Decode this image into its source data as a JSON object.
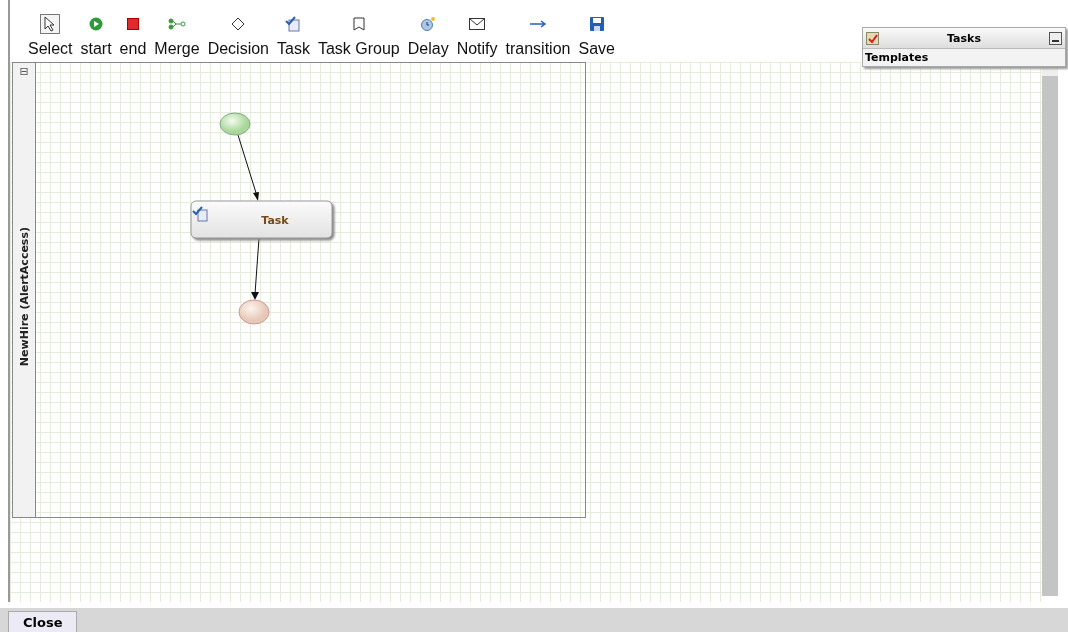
{
  "toolbar": [
    {
      "kind": "select",
      "label": "Select",
      "selected": true
    },
    {
      "kind": "start",
      "label": "start",
      "selected": false
    },
    {
      "kind": "end",
      "label": "end",
      "selected": false
    },
    {
      "kind": "merge",
      "label": "Merge",
      "selected": false
    },
    {
      "kind": "decision",
      "label": "Decision",
      "selected": false
    },
    {
      "kind": "task",
      "label": "Task",
      "selected": false
    },
    {
      "kind": "taskgroup",
      "label": "Task Group",
      "selected": false
    },
    {
      "kind": "delay",
      "label": "Delay",
      "selected": false
    },
    {
      "kind": "notify",
      "label": "Notify",
      "selected": false
    },
    {
      "kind": "transition",
      "label": "transition",
      "selected": false
    },
    {
      "kind": "save",
      "label": "Save",
      "selected": false
    }
  ],
  "pool": {
    "lane_label": "NewHire (AlertAccess)",
    "collapse_symbol": "⊟"
  },
  "nodes": [
    {
      "kind": "start"
    },
    {
      "kind": "task",
      "label": "Task"
    },
    {
      "kind": "end"
    }
  ],
  "tasks_panel": {
    "title": "Tasks",
    "section": "Templates"
  },
  "footer": {
    "button": "Close"
  }
}
